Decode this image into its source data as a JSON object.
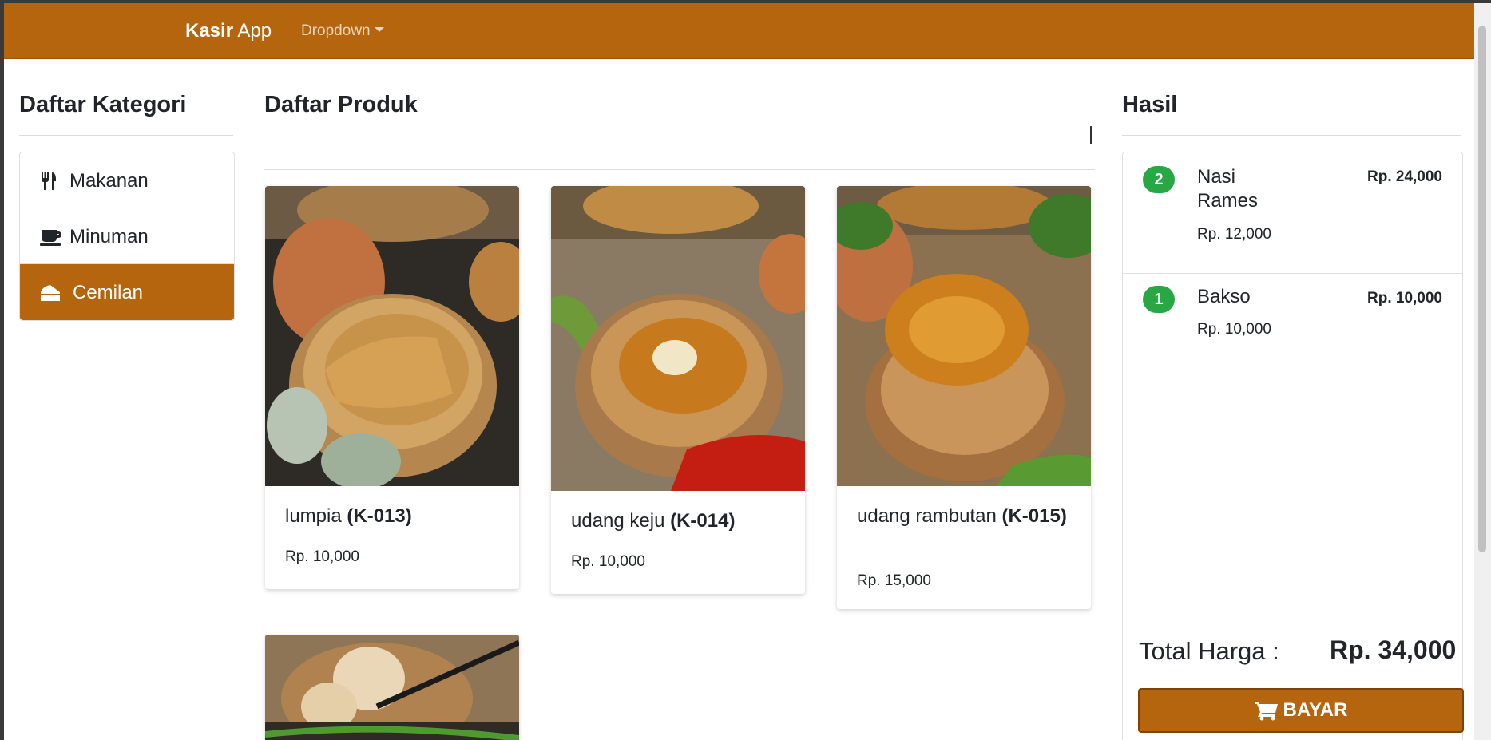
{
  "navbar": {
    "brand_bold": "Kasir",
    "brand_rest": " App",
    "dropdown_label": "Dropdown"
  },
  "categories": {
    "heading": "Daftar Kategori",
    "items": [
      {
        "label": "Makanan",
        "icon": "utensils-icon",
        "active": false
      },
      {
        "label": "Minuman",
        "icon": "coffee-icon",
        "active": false
      },
      {
        "label": "Cemilan",
        "icon": "cheese-icon",
        "active": true
      }
    ]
  },
  "products": {
    "heading": "Daftar Produk",
    "items": [
      {
        "name": "lumpia ",
        "code": "(K-013)",
        "price": "Rp. 10,000"
      },
      {
        "name": "udang keju ",
        "code": "(K-014)",
        "price": "Rp. 10,000"
      },
      {
        "name": "udang rambutan ",
        "code": "(K-015)",
        "price": "Rp. 15,000"
      },
      {
        "name": "",
        "code": "",
        "price": ""
      }
    ]
  },
  "cart": {
    "heading": "Hasil",
    "items": [
      {
        "qty": "2",
        "name": "Nasi Rames",
        "unit_price": "Rp. 12,000",
        "total": "Rp. 24,000"
      },
      {
        "qty": "1",
        "name": "Bakso",
        "unit_price": "Rp. 10,000",
        "total": "Rp. 10,000"
      }
    ],
    "total_label": "Total Harga :",
    "total_value": "Rp. 34,000",
    "pay_button": "BAYAR"
  },
  "colors": {
    "primary": "#b5650d",
    "badge": "#28a745"
  }
}
